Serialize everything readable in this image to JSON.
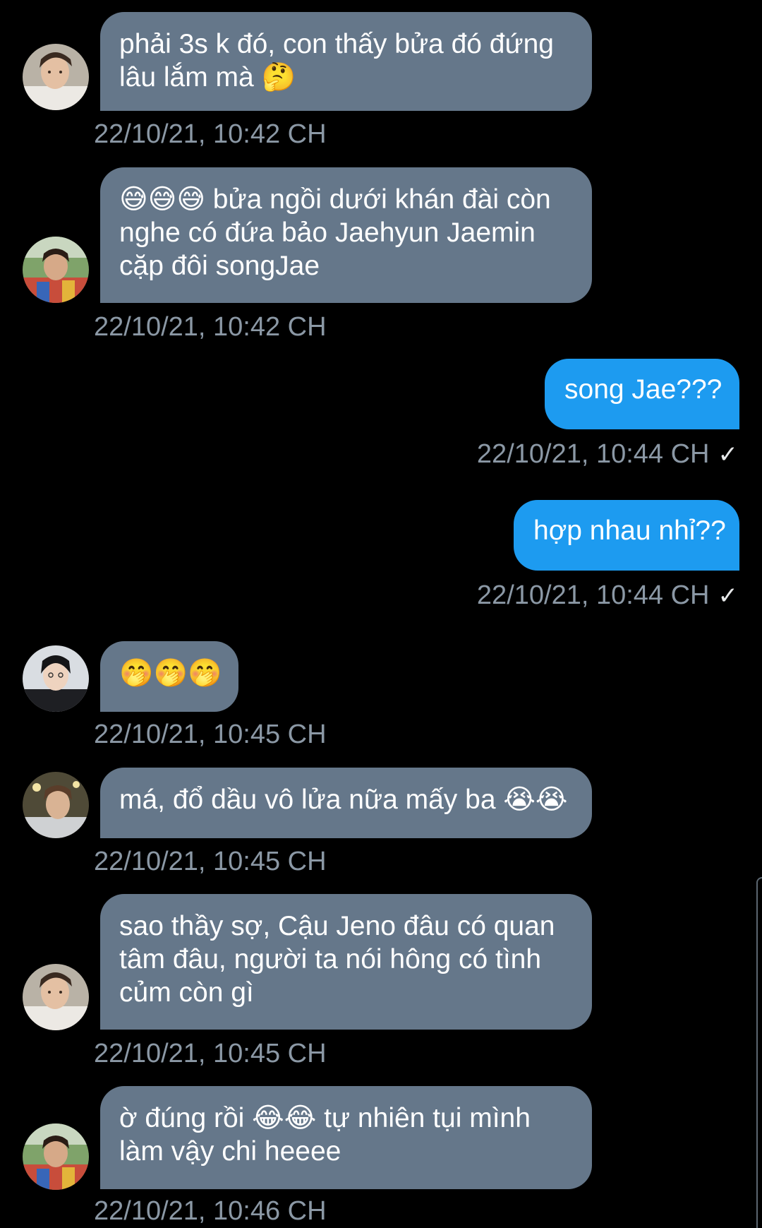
{
  "conversation": {
    "messages": [
      {
        "direction": "in",
        "lines": [
          "phải 3s k đó, con thấy bửa đó đứng",
          "lâu lắm mà 🤔"
        ],
        "timestamp": "22/10/21, 10:42 CH"
      },
      {
        "direction": "in",
        "lines": [
          "😅😅😅 bửa ngồi dưới khán đài còn",
          "nghe có đứa bảo Jaehyun Jaemin",
          "cặp đôi songJae"
        ],
        "timestamp": "22/10/21, 10:42 CH"
      },
      {
        "direction": "out",
        "lines": [
          "song Jae???"
        ],
        "timestamp": "22/10/21, 10:44 CH",
        "status_icon": "check-icon"
      },
      {
        "direction": "out",
        "lines": [
          "hợp nhau nhỉ??"
        ],
        "timestamp": "22/10/21, 10:44 CH",
        "status_icon": "check-icon"
      },
      {
        "direction": "in",
        "lines": [
          "🤭🤭🤭"
        ],
        "timestamp": "22/10/21, 10:45 CH"
      },
      {
        "direction": "in",
        "lines": [
          "má, đổ dầu vô lửa nữa mấy ba 😭😭"
        ],
        "timestamp": "22/10/21, 10:45 CH"
      },
      {
        "direction": "in",
        "lines": [
          "sao thầy sợ, Cậu Jeno đâu có quan",
          "tâm đâu, người ta nói hông có tình",
          "củm còn gì"
        ],
        "timestamp": "22/10/21, 10:45 CH"
      },
      {
        "direction": "in",
        "lines": [
          "ờ đúng rồi 😂😂 tự nhiên tụi mình",
          "làm vậy chi heeee"
        ],
        "timestamp": "22/10/21, 10:46 CH"
      }
    ]
  },
  "theme": {
    "background": "#000000",
    "incoming_bubble": "#65778a",
    "outgoing_bubble": "#1d9bf0",
    "timestamp_color": "#8b98a5"
  }
}
